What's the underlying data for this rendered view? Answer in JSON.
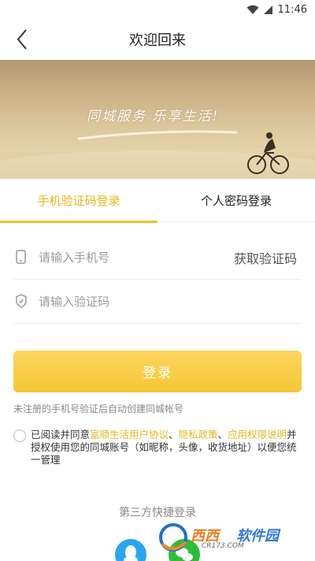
{
  "status_bar": {
    "time": "11:46",
    "icons": [
      "wifi-icon",
      "signal-icon"
    ]
  },
  "header": {
    "title": "欢迎回来",
    "back_icon": "chevron-left-icon"
  },
  "banner": {
    "slogan": "同城服务  乐享生活!"
  },
  "tabs": [
    {
      "label": "手机验证码登录",
      "active": true
    },
    {
      "label": "个人密码登录",
      "active": false
    }
  ],
  "form": {
    "phone": {
      "placeholder": "请输入手机号",
      "value": "",
      "icon": "phone-icon"
    },
    "get_code_label": "获取验证码",
    "code": {
      "placeholder": "请输入验证码",
      "value": "",
      "icon": "shield-icon"
    }
  },
  "login_button": {
    "label": "登录"
  },
  "hint": "未注册的手机号验证后自动创建同城帐号",
  "agreement": {
    "prefix": "已阅读并同意",
    "link_user_agreement": "富顺生活用户协议",
    "sep1": "、",
    "link_privacy": "隐私政策",
    "sep2": "、",
    "link_permissions": "应用权限说明",
    "suffix": "并授权使用您的同城账号（如昵称，头像，收货地址）以便您统一管理"
  },
  "third_party": {
    "title": "第三方快捷登录",
    "icons": [
      "qq-icon",
      "wechat-icon"
    ]
  },
  "watermark": {
    "text1": "西西",
    "text2": "软件园",
    "sub": "CR173.COM"
  },
  "colors": {
    "accent": "#f2be22",
    "accent_text": "#e9b51c",
    "qq": "#29a5f2",
    "wechat": "#2dbd3a"
  }
}
